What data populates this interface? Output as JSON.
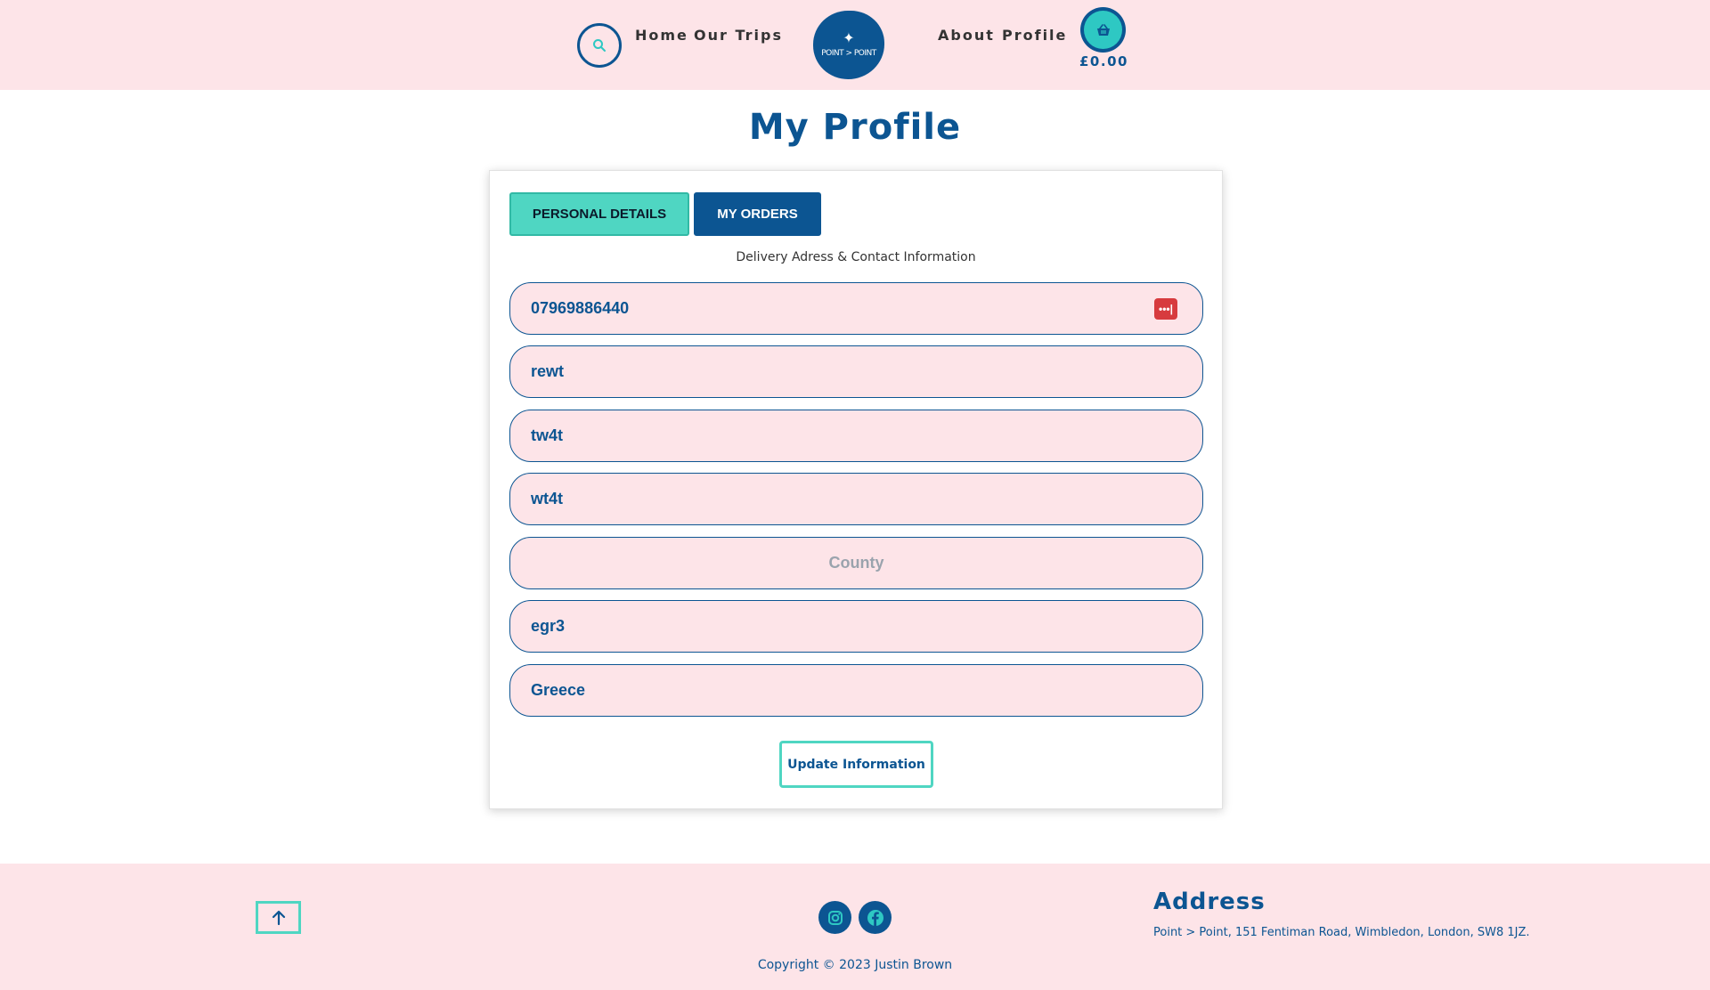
{
  "header": {
    "nav_left": [
      "Home",
      "Our Trips"
    ],
    "nav_right": [
      "About",
      "Profile"
    ],
    "logo_text": "POINT > POINT",
    "cart_total": "£0.00"
  },
  "page_title": "My Profile",
  "tabs": {
    "personal": "PERSONAL DETAILS",
    "orders": "MY ORDERS"
  },
  "section_label": "Delivery Adress & Contact Information",
  "fields": [
    {
      "value": "07969886440",
      "placeholder": ""
    },
    {
      "value": "rewt",
      "placeholder": ""
    },
    {
      "value": "tw4t",
      "placeholder": ""
    },
    {
      "value": "wt4t",
      "placeholder": ""
    },
    {
      "value": "",
      "placeholder": "County"
    },
    {
      "value": "egr3",
      "placeholder": ""
    },
    {
      "value": "Greece",
      "placeholder": ""
    }
  ],
  "update_button": "Update Information",
  "footer": {
    "copyright": "Copyright © 2023 Justin Brown",
    "address_title": "Address",
    "address_text": "Point > Point, 151 Fentiman Road, Wimbledon, London, SW8 1JZ."
  },
  "icons": {
    "search": "search-icon",
    "cart": "basket-icon",
    "autofill": "password-manager-icon",
    "back_to_top": "arrow-up-icon",
    "instagram": "instagram-icon",
    "facebook": "facebook-icon"
  },
  "colors": {
    "primary": "#0c5592",
    "accent": "#4fd6c2",
    "pink_bg": "#fde4e8"
  }
}
